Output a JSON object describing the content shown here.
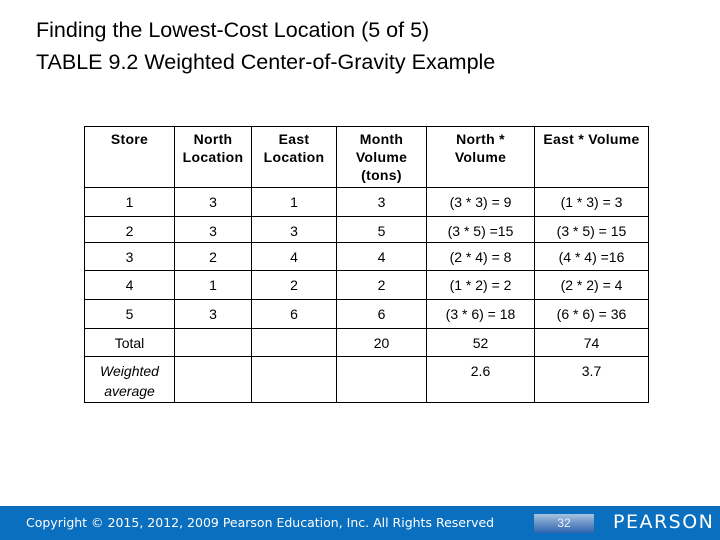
{
  "slide": {
    "title_line1": "Finding the Lowest-Cost Location (5 of 5)",
    "title_line2": "TABLE 9.2 Weighted Center-of-Gravity Example"
  },
  "table": {
    "headers": [
      [
        "Store"
      ],
      [
        "North",
        "Location"
      ],
      [
        "East",
        "Location"
      ],
      [
        "Month",
        "Volume",
        "(tons)"
      ],
      [
        "North *",
        "Volume"
      ],
      [
        "East * Volume"
      ]
    ],
    "rows": [
      [
        "1",
        "3",
        "1",
        "3",
        "(3 * 3) = 9",
        "(1 * 3) = 3"
      ],
      [
        "2",
        "3",
        "3",
        "5",
        "(3 * 5) =15",
        "(3 * 5) = 15"
      ],
      [
        "3",
        "2",
        "4",
        "4",
        "(2 * 4) = 8",
        "(4 * 4) =16"
      ],
      [
        "4",
        "1",
        "2",
        "2",
        "(1 * 2) = 2",
        "(2 * 2) = 4"
      ],
      [
        "5",
        "3",
        "6",
        "6",
        "(3 * 6) = 18",
        "(6 * 6) = 36"
      ]
    ],
    "total": {
      "label": "Total",
      "north": "",
      "east": "",
      "volume": "20",
      "north_volume": "52",
      "east_volume": "74"
    },
    "weighted_average": {
      "label_line1": "Weighted",
      "label_line2": "average",
      "north": "",
      "east": "",
      "volume": "",
      "north_volume": "2.6",
      "east_volume": "3.7"
    }
  },
  "footer": {
    "copyright": "Copyright © 2015, 2012, 2009 Pearson Education, Inc. All Rights Reserved",
    "page_number": "32",
    "brand": "PEARSON",
    "bar_color": "#0a6fbf"
  }
}
